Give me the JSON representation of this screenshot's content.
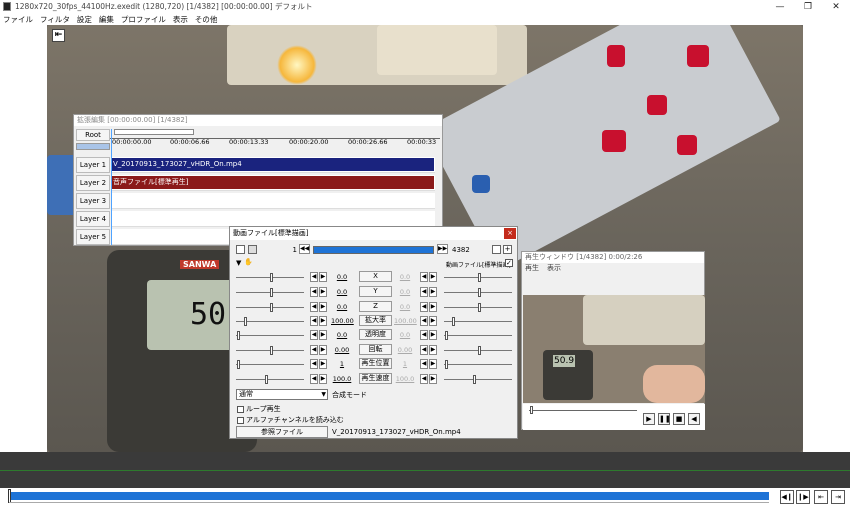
{
  "window": {
    "title": "1280x720_30fps_44100Hz.exedit (1280,720)  [1/4382]  [00:00:00.00]  デフォルト",
    "minimize": "—",
    "maximize": "❐",
    "close": "✕"
  },
  "menu": [
    "ファイル",
    "フィルタ",
    "設定",
    "編集",
    "プロファイル",
    "表示",
    "その他"
  ],
  "ext_edit": {
    "title": "拡張編集 [00:00:00.00] [1/4382]",
    "root_label": "Root",
    "ruler": [
      "00:00:00.00",
      "00:00:06.66",
      "00:00:13.33",
      "00:00:20.00",
      "00:00:26.66",
      "00:00:33"
    ],
    "layers": [
      "Layer 1",
      "Layer 2",
      "Layer 3",
      "Layer 4",
      "Layer 5"
    ],
    "clip1": "V_20170913_173027_vHDR_On.mp4",
    "clip2": "音声ファイル[標準再生]",
    "clip1_color": "#1a237e",
    "clip2_color": "#8b1a1a"
  },
  "dialog": {
    "title": "動画ファイル[標準描画]",
    "close": "×",
    "frame_start": "1",
    "frame_end": "4382",
    "label_right": "動画ファイル[標準描画]",
    "params": [
      {
        "name": "X",
        "left": "0.0",
        "right": "0.0"
      },
      {
        "name": "Y",
        "left": "0.0",
        "right": "0.0"
      },
      {
        "name": "Z",
        "left": "0.0",
        "right": "0.0"
      },
      {
        "name": "拡大率",
        "left": "100.00",
        "right": "100.00"
      },
      {
        "name": "透明度",
        "left": "0.0",
        "right": "0.0"
      },
      {
        "name": "回転",
        "left": "0.00",
        "right": "0.00"
      },
      {
        "name": "再生位置",
        "left": "1",
        "right": "1"
      },
      {
        "name": "再生速度",
        "left": "100.0",
        "right": "100.0"
      }
    ],
    "blend_value": "通常",
    "blend_label": "合成モード",
    "loop_label": "ループ再生",
    "alpha_label": "アルファチャンネルを読み込む",
    "ref_button": "参照ファイル",
    "filename": "V_20170913_173027_vHDR_On.mp4"
  },
  "preview": {
    "title": "再生ウィンドウ [1/4382]  0:00/2:26",
    "menu": [
      "再生",
      "表示"
    ],
    "meter_reading": "50.9"
  },
  "display": {
    "meter_reading": "50.9",
    "meter_brand": "SANWA"
  },
  "progress": 0.99
}
